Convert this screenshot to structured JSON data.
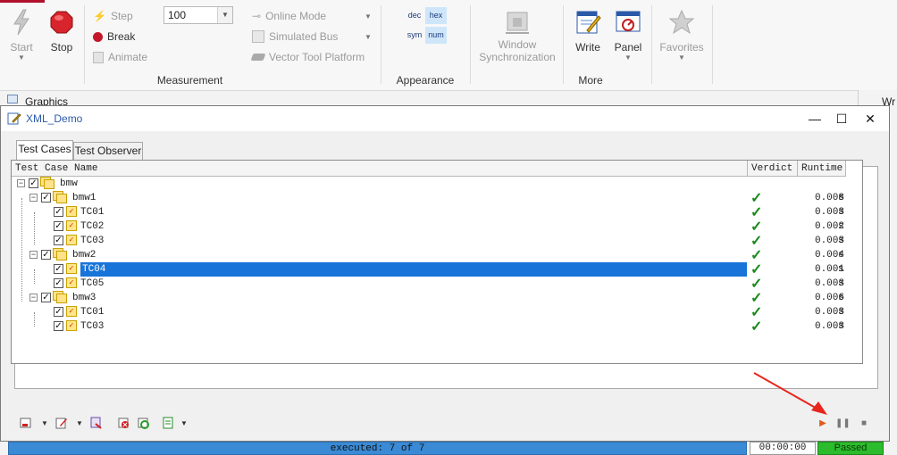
{
  "ribbon": {
    "start_label": "Start",
    "stop_label": "Stop",
    "step_label": "Step",
    "break_label": "Break",
    "animate_label": "Animate",
    "speed_value": "100",
    "online_mode_label": "Online Mode",
    "simulated_bus_label": "Simulated Bus",
    "vector_tool_platform_label": "Vector Tool Platform",
    "measurement_group": "Measurement",
    "appearance": {
      "dec": "dec",
      "hex": "hex",
      "sym": "sym",
      "num": "num"
    },
    "appearance_group": "Appearance",
    "window_sync_line1": "Window",
    "window_sync_line2": "Synchronization",
    "write_label": "Write",
    "panel_label": "Panel",
    "favorites_label": "Favorites",
    "more_group": "More"
  },
  "background": {
    "graphics_tab": "Graphics",
    "right_tab": "Wr"
  },
  "window": {
    "title": "XML_Demo",
    "tabs": [
      "Test Cases",
      "Test Observer"
    ],
    "columns": {
      "name": "Test Case Name",
      "verdict": "Verdict",
      "runtime": "Runtime"
    },
    "rows": [
      {
        "name": "bmw",
        "level": 0,
        "type": "group",
        "verdict": "",
        "runtime": ""
      },
      {
        "name": "bmw1",
        "level": 1,
        "type": "group",
        "verdict": "✓",
        "runtime": "0.008",
        "unit": "s"
      },
      {
        "name": "TC01",
        "level": 2,
        "type": "case",
        "verdict": "✓",
        "runtime": "0.003",
        "unit": "s"
      },
      {
        "name": "TC02",
        "level": 2,
        "type": "case",
        "verdict": "✓",
        "runtime": "0.002",
        "unit": "s"
      },
      {
        "name": "TC03",
        "level": 2,
        "type": "case",
        "verdict": "✓",
        "runtime": "0.003",
        "unit": "s"
      },
      {
        "name": "bmw2",
        "level": 1,
        "type": "group",
        "verdict": "✓",
        "runtime": "0.004",
        "unit": "s"
      },
      {
        "name": "TC04",
        "level": 2,
        "type": "case",
        "verdict": "✓",
        "runtime": "0.001",
        "unit": "s",
        "selected": true
      },
      {
        "name": "TC05",
        "level": 2,
        "type": "case",
        "verdict": "✓",
        "runtime": "0.003",
        "unit": "s"
      },
      {
        "name": "bmw3",
        "level": 1,
        "type": "group",
        "verdict": "✓",
        "runtime": "0.006",
        "unit": "s"
      },
      {
        "name": "TC01",
        "level": 2,
        "type": "case",
        "verdict": "✓",
        "runtime": "0.003",
        "unit": "s"
      },
      {
        "name": "TC03",
        "level": 2,
        "type": "case",
        "verdict": "✓",
        "runtime": "0.003",
        "unit": "s"
      }
    ],
    "progress_text": "executed: 7 of 7",
    "elapsed_time": "00:00:00",
    "status": "Passed"
  },
  "colors": {
    "selection": "#1874d8",
    "passed": "#2cbb2c",
    "progress": "#3a8ad6",
    "arrow": "#e8261c"
  }
}
